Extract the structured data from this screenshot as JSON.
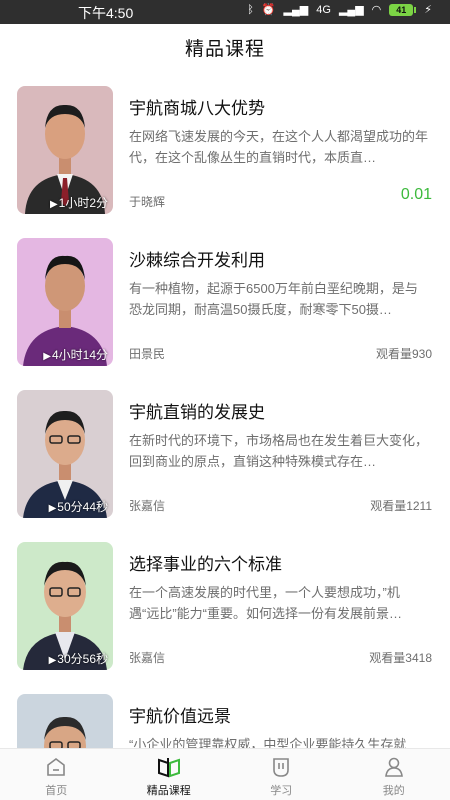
{
  "status_bar": {
    "time": "下午4:50",
    "network": "4G",
    "battery": "41"
  },
  "header": {
    "title": "精品课程"
  },
  "courses": [
    {
      "title": "宇航商城八大优势",
      "desc": "在网络飞速发展的今天，在这个人人都渴望成功的年代，在这个乱像丛生的直销时代，本质直…",
      "author": "于晓辉",
      "duration": "1小时2分",
      "price": "0.01",
      "bg": "#d9b9bc",
      "suit": "#2a2a2a",
      "tie": "#8b1f2a"
    },
    {
      "title": "沙棘综合开发利用",
      "desc": "有一种植物，起源于6500万年前白垩纪晚期，是与恐龙同期，耐高温50摄氏度，耐寒零下50摄…",
      "author": "田景民",
      "duration": "4小时14分",
      "views": "观看量930",
      "bg": "#e4b7e2",
      "suit": "#6a2a7a",
      "tie": "#6a2a7a"
    },
    {
      "title": "宇航直销的发展史",
      "desc": "在新时代的环境下，市场格局也在发生着巨大变化，回到商业的原点，直销这种特殊模式存在…",
      "author": "张嘉信",
      "duration": "50分44秒",
      "views": "观看量1211",
      "bg": "#d9cfd2",
      "suit": "#1f2a44",
      "tie": "#1f2a44"
    },
    {
      "title": "选择事业的六个标准",
      "desc": "在一个高速发展的时代里，一个人要想成功，”机遇“远比”能力“重要。如何选择一份有发展前景…",
      "author": "张嘉信",
      "duration": "30分56秒",
      "views": "观看量3418",
      "bg": "#cde9c9",
      "suit": "#25293a",
      "tie": "#e8e8ee"
    },
    {
      "title": "宇航价值远景",
      "desc": "“小企业的管理靠权威，中型企业要能持久生存就",
      "author": "",
      "duration": "",
      "views": "",
      "bg": "#cbd5de",
      "suit": "#2b2b2b",
      "tie": "#2b2b2b"
    }
  ],
  "tabs": [
    {
      "label": "首页",
      "icon": "home-icon",
      "active": false
    },
    {
      "label": "精品课程",
      "icon": "book-icon",
      "active": true
    },
    {
      "label": "学习",
      "icon": "study-icon",
      "active": false
    },
    {
      "label": "我的",
      "icon": "user-icon",
      "active": false
    }
  ]
}
